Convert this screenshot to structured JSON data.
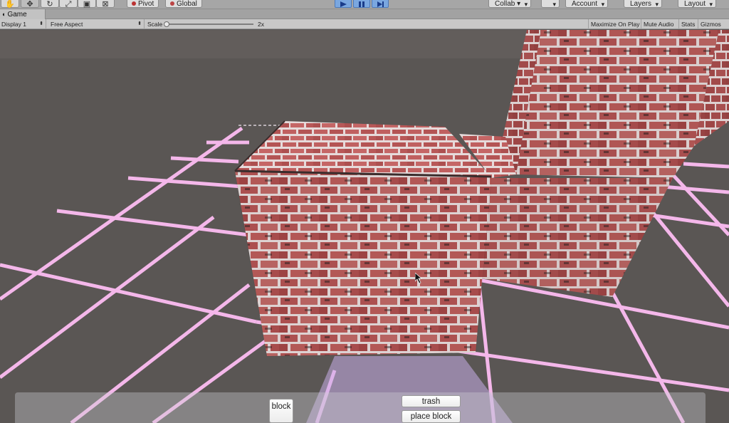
{
  "toolbar": {
    "tools": [
      "hand-tool",
      "move-tool",
      "rotate-tool",
      "scale-tool",
      "rect-tool",
      "transform-tool"
    ],
    "pivot_label": "Pivot",
    "global_label": "Global",
    "collab_label": "Collab ▾",
    "account_label": "Account",
    "layers_label": "Layers",
    "layout_label": "Layout"
  },
  "tab": {
    "title": "Game"
  },
  "game_options": {
    "display": "Display 1",
    "aspect": "Free Aspect",
    "scale_label": "Scale",
    "scale_value": "2x",
    "maximize_label": "Maximize On Play",
    "mute_label": "Mute Audio",
    "stats_label": "Stats",
    "gizmos_label": "Gizmos"
  },
  "game_ui": {
    "block_label": "block",
    "trash_label": "trash",
    "place_block_label": "place block"
  },
  "colors": {
    "ground": "#5a5654",
    "grid_line": "#f4b7ea",
    "brick": "#b85a5a",
    "mortar": "#efe3e3"
  }
}
